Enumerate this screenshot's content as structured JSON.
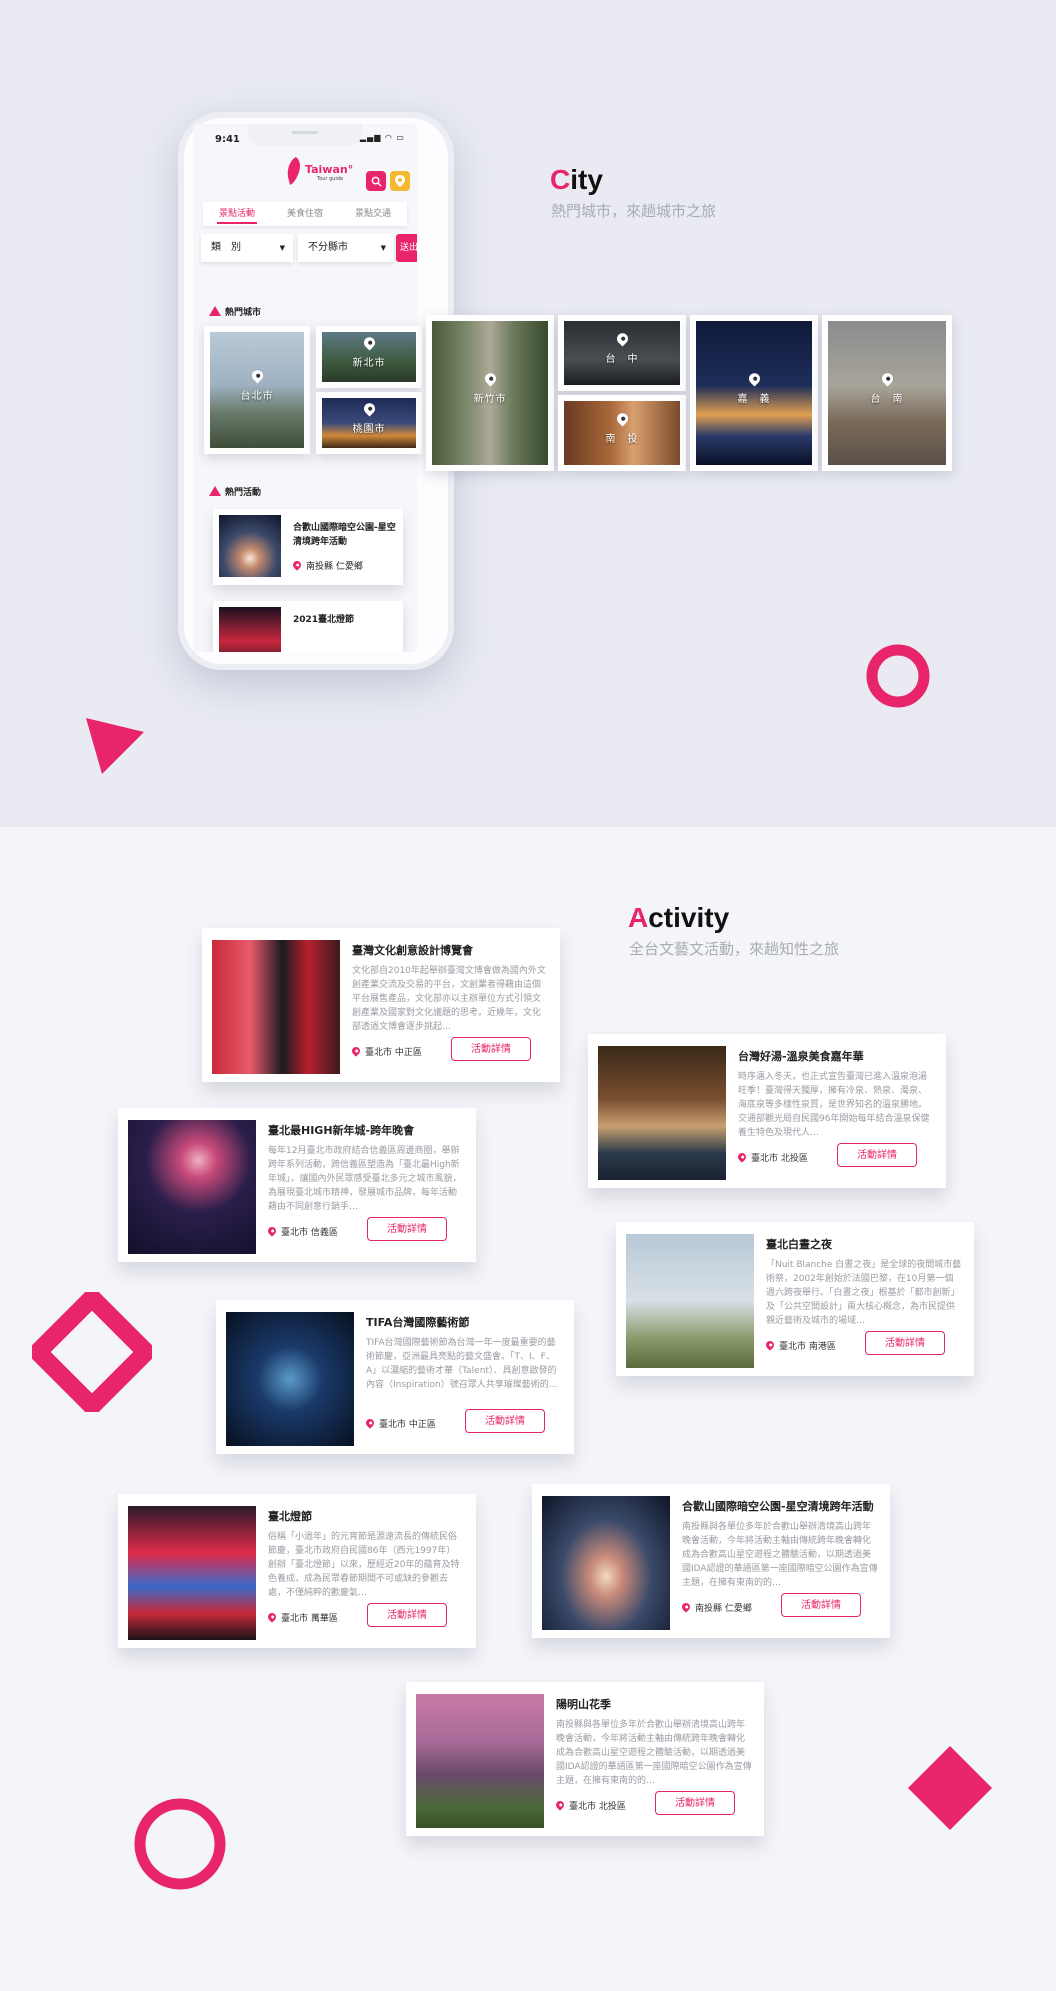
{
  "colors": {
    "accent": "#e8246a",
    "yellow": "#f5b82e",
    "muted": "#a9abb3"
  },
  "phone": {
    "time": "9:41",
    "logo": {
      "name": "Taiwan",
      "mark": "°",
      "sub": "Tour guide"
    },
    "icons": {
      "search": "search-icon",
      "location": "location-icon"
    },
    "tabs": [
      "景點活動",
      "美食住宿",
      "景點交通"
    ],
    "active_tab": 0,
    "filters": {
      "category": "類　別",
      "city": "不分縣市",
      "submit": "送出"
    },
    "hot_cities_title": "熱門城市",
    "hot_activities_title": "熱門活動",
    "activities": [
      {
        "title": "合歡山國際暗空公園-星空清境跨年活動",
        "location": "南投縣 仁愛鄉"
      },
      {
        "title": "2021臺北燈節"
      }
    ]
  },
  "city_section": {
    "heading_first": "C",
    "heading_rest": "ity",
    "subtitle": "熱門城市，來趟城市之旅",
    "cities": [
      "台北市",
      "新北市",
      "桃園市",
      "新竹市",
      "台　中",
      "南　投",
      "嘉　義",
      "台　南"
    ]
  },
  "activity_section": {
    "heading_first": "A",
    "heading_rest": "ctivity",
    "subtitle": "全台文藝文活動，來趟知性之旅",
    "button_label": "活動詳情",
    "cards": [
      {
        "title": "臺灣文化創意設計博覽會",
        "desc": "文化部自2010年起舉辦臺灣文博會做為國內外文創產業交流及交易的平台，文創業者得藉由這個平台展售產品，文化部亦以主辦單位方式引領文創產業及國家對文化議題的思考。近幾年，文化部透過文博會逐步挑起…",
        "location": "臺北市 中正區"
      },
      {
        "title": "台灣好湯-溫泉美食嘉年華",
        "desc": "時序邁入冬天，也正式宣告臺灣已進入溫泉泡湯旺季！臺灣得天獨厚，擁有冷泉、熱泉、濁泉、海底泉等多樣性泉質，是世界知名的溫泉勝地。交通部觀光局自民國96年開始每年結合溫泉保健養生特色及現代人…",
        "location": "臺北市 北投區"
      },
      {
        "title": "臺北最HIGH新年城-跨年晚會",
        "desc": "每年12月臺北市政府結合信義區周邊商圈，舉辦跨年系列活動，跨信義區塑造為「臺北最High新年城」，讓國內外民眾感受臺北多元之城市風貌，為展現臺北城市精神，發展城市品牌，每年活動藉由不同創意行銷手…",
        "location": "臺北市 信義區"
      },
      {
        "title": "臺北白晝之夜",
        "desc": "「Nuit Blanche 白晝之夜」是全球的夜間城市藝術祭，2002年創始於法國巴黎，在10月第一個週六跨夜舉行。「白晝之夜」根基於「都市創新」及「公共空間設計」兩大核心概念，為市民提供親近藝術及城市的場域…",
        "location": "臺北市 南港區"
      },
      {
        "title": "TIFA台灣國際藝術節",
        "desc": "TIFA台灣國際藝術節為台灣一年一度最重要的藝術節慶，亞洲最具亮點的藝文盛會。「T、I、F、A」以濃縮的藝術才華（Talent）、具創意啟發的內容（Inspiration）號召眾人共享璀璨藝術的…",
        "location": "臺北市 中正區"
      },
      {
        "title": "臺北燈節",
        "desc": "俗稱「小過年」的元宵節是源遠流長的傳統民俗節慶，臺北市政府自民國86年（西元1997年）創辦「臺北燈節」以來，歷經近20年的蘊育及特色養成，成為民眾春節期間不可或缺的參觀去處，不僅純粹的歡慶氣…",
        "location": "臺北市 萬華區"
      },
      {
        "title": "合歡山國際暗空公園-星空清境跨年活動",
        "desc": "南投縣與各單位多年於合歡山舉辦清境高山跨年晚會活動，今年將活動主軸由傳統跨年晚會轉化成為合歡高山星空遊程之體驗活動，以期透過美國IDA認證的華語區第一座國際暗空公園作為宣傳主題，在擁有東南的的…",
        "location": "南投縣 仁愛鄉"
      },
      {
        "title": "陽明山花季",
        "desc": "南投縣與各單位多年於合歡山舉辦清境高山跨年晚會活動，今年將活動主軸由傳統跨年晚會轉化成為合歡高山星空遊程之體驗活動，以期透過美國IDA認證的華語區第一座國際暗空公園作為宣傳主題，在擁有東南的的…",
        "location": "臺北市 北投區"
      }
    ]
  }
}
